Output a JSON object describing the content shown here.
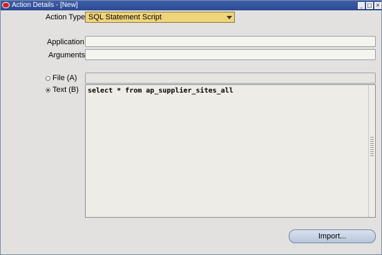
{
  "window": {
    "title": "Action Details - [New]"
  },
  "labels": {
    "action_type": "Action Type",
    "application": "Application",
    "arguments": "Arguments",
    "file": "File (A)",
    "text": "Text (B)"
  },
  "action_type": {
    "selected": "SQL Statement Script"
  },
  "fields": {
    "application": "",
    "arguments": "",
    "file": ""
  },
  "text_content": "select * from ap_supplier_sites_all",
  "radio_selected": "text",
  "buttons": {
    "import": "Import..."
  },
  "icons": {
    "title_logo": "oracle-logo-icon",
    "minimize": "minimize-icon",
    "maximize": "maximize-icon",
    "close": "close-icon",
    "dropdown": "chevron-down-icon"
  },
  "colors": {
    "titlebar": "#2b4a93",
    "select_bg": "#f0d47a",
    "window_bg": "#e3e1df"
  }
}
